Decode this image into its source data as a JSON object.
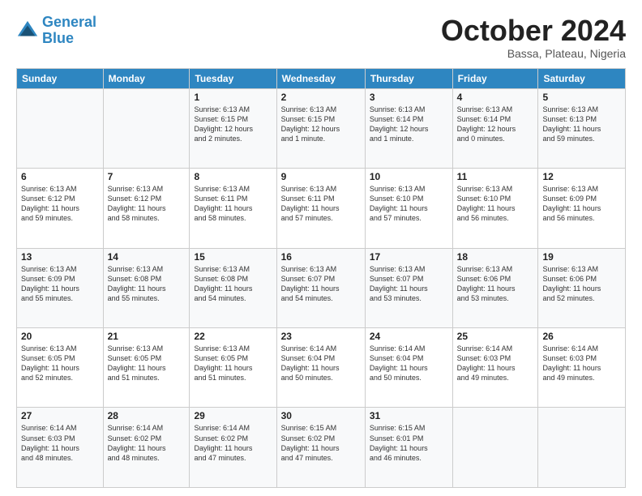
{
  "header": {
    "logo_line1": "General",
    "logo_line2": "Blue",
    "month_title": "October 2024",
    "location": "Bassa, Plateau, Nigeria"
  },
  "days_of_week": [
    "Sunday",
    "Monday",
    "Tuesday",
    "Wednesday",
    "Thursday",
    "Friday",
    "Saturday"
  ],
  "weeks": [
    [
      {
        "day": "",
        "content": ""
      },
      {
        "day": "",
        "content": ""
      },
      {
        "day": "1",
        "content": "Sunrise: 6:13 AM\nSunset: 6:15 PM\nDaylight: 12 hours\nand 2 minutes."
      },
      {
        "day": "2",
        "content": "Sunrise: 6:13 AM\nSunset: 6:15 PM\nDaylight: 12 hours\nand 1 minute."
      },
      {
        "day": "3",
        "content": "Sunrise: 6:13 AM\nSunset: 6:14 PM\nDaylight: 12 hours\nand 1 minute."
      },
      {
        "day": "4",
        "content": "Sunrise: 6:13 AM\nSunset: 6:14 PM\nDaylight: 12 hours\nand 0 minutes."
      },
      {
        "day": "5",
        "content": "Sunrise: 6:13 AM\nSunset: 6:13 PM\nDaylight: 11 hours\nand 59 minutes."
      }
    ],
    [
      {
        "day": "6",
        "content": "Sunrise: 6:13 AM\nSunset: 6:12 PM\nDaylight: 11 hours\nand 59 minutes."
      },
      {
        "day": "7",
        "content": "Sunrise: 6:13 AM\nSunset: 6:12 PM\nDaylight: 11 hours\nand 58 minutes."
      },
      {
        "day": "8",
        "content": "Sunrise: 6:13 AM\nSunset: 6:11 PM\nDaylight: 11 hours\nand 58 minutes."
      },
      {
        "day": "9",
        "content": "Sunrise: 6:13 AM\nSunset: 6:11 PM\nDaylight: 11 hours\nand 57 minutes."
      },
      {
        "day": "10",
        "content": "Sunrise: 6:13 AM\nSunset: 6:10 PM\nDaylight: 11 hours\nand 57 minutes."
      },
      {
        "day": "11",
        "content": "Sunrise: 6:13 AM\nSunset: 6:10 PM\nDaylight: 11 hours\nand 56 minutes."
      },
      {
        "day": "12",
        "content": "Sunrise: 6:13 AM\nSunset: 6:09 PM\nDaylight: 11 hours\nand 56 minutes."
      }
    ],
    [
      {
        "day": "13",
        "content": "Sunrise: 6:13 AM\nSunset: 6:09 PM\nDaylight: 11 hours\nand 55 minutes."
      },
      {
        "day": "14",
        "content": "Sunrise: 6:13 AM\nSunset: 6:08 PM\nDaylight: 11 hours\nand 55 minutes."
      },
      {
        "day": "15",
        "content": "Sunrise: 6:13 AM\nSunset: 6:08 PM\nDaylight: 11 hours\nand 54 minutes."
      },
      {
        "day": "16",
        "content": "Sunrise: 6:13 AM\nSunset: 6:07 PM\nDaylight: 11 hours\nand 54 minutes."
      },
      {
        "day": "17",
        "content": "Sunrise: 6:13 AM\nSunset: 6:07 PM\nDaylight: 11 hours\nand 53 minutes."
      },
      {
        "day": "18",
        "content": "Sunrise: 6:13 AM\nSunset: 6:06 PM\nDaylight: 11 hours\nand 53 minutes."
      },
      {
        "day": "19",
        "content": "Sunrise: 6:13 AM\nSunset: 6:06 PM\nDaylight: 11 hours\nand 52 minutes."
      }
    ],
    [
      {
        "day": "20",
        "content": "Sunrise: 6:13 AM\nSunset: 6:05 PM\nDaylight: 11 hours\nand 52 minutes."
      },
      {
        "day": "21",
        "content": "Sunrise: 6:13 AM\nSunset: 6:05 PM\nDaylight: 11 hours\nand 51 minutes."
      },
      {
        "day": "22",
        "content": "Sunrise: 6:13 AM\nSunset: 6:05 PM\nDaylight: 11 hours\nand 51 minutes."
      },
      {
        "day": "23",
        "content": "Sunrise: 6:14 AM\nSunset: 6:04 PM\nDaylight: 11 hours\nand 50 minutes."
      },
      {
        "day": "24",
        "content": "Sunrise: 6:14 AM\nSunset: 6:04 PM\nDaylight: 11 hours\nand 50 minutes."
      },
      {
        "day": "25",
        "content": "Sunrise: 6:14 AM\nSunset: 6:03 PM\nDaylight: 11 hours\nand 49 minutes."
      },
      {
        "day": "26",
        "content": "Sunrise: 6:14 AM\nSunset: 6:03 PM\nDaylight: 11 hours\nand 49 minutes."
      }
    ],
    [
      {
        "day": "27",
        "content": "Sunrise: 6:14 AM\nSunset: 6:03 PM\nDaylight: 11 hours\nand 48 minutes."
      },
      {
        "day": "28",
        "content": "Sunrise: 6:14 AM\nSunset: 6:02 PM\nDaylight: 11 hours\nand 48 minutes."
      },
      {
        "day": "29",
        "content": "Sunrise: 6:14 AM\nSunset: 6:02 PM\nDaylight: 11 hours\nand 47 minutes."
      },
      {
        "day": "30",
        "content": "Sunrise: 6:15 AM\nSunset: 6:02 PM\nDaylight: 11 hours\nand 47 minutes."
      },
      {
        "day": "31",
        "content": "Sunrise: 6:15 AM\nSunset: 6:01 PM\nDaylight: 11 hours\nand 46 minutes."
      },
      {
        "day": "",
        "content": ""
      },
      {
        "day": "",
        "content": ""
      }
    ]
  ]
}
